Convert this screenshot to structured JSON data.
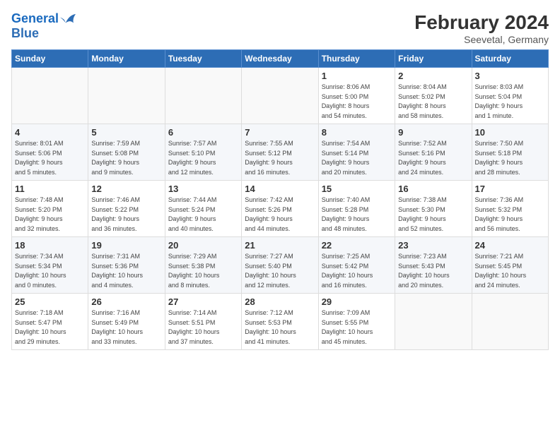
{
  "header": {
    "logo_line1": "General",
    "logo_line2": "Blue",
    "title": "February 2024",
    "subtitle": "Seevetal, Germany"
  },
  "days_of_week": [
    "Sunday",
    "Monday",
    "Tuesday",
    "Wednesday",
    "Thursday",
    "Friday",
    "Saturday"
  ],
  "weeks": [
    [
      {
        "day": "",
        "info": ""
      },
      {
        "day": "",
        "info": ""
      },
      {
        "day": "",
        "info": ""
      },
      {
        "day": "",
        "info": ""
      },
      {
        "day": "1",
        "info": "Sunrise: 8:06 AM\nSunset: 5:00 PM\nDaylight: 8 hours\nand 54 minutes."
      },
      {
        "day": "2",
        "info": "Sunrise: 8:04 AM\nSunset: 5:02 PM\nDaylight: 8 hours\nand 58 minutes."
      },
      {
        "day": "3",
        "info": "Sunrise: 8:03 AM\nSunset: 5:04 PM\nDaylight: 9 hours\nand 1 minute."
      }
    ],
    [
      {
        "day": "4",
        "info": "Sunrise: 8:01 AM\nSunset: 5:06 PM\nDaylight: 9 hours\nand 5 minutes."
      },
      {
        "day": "5",
        "info": "Sunrise: 7:59 AM\nSunset: 5:08 PM\nDaylight: 9 hours\nand 9 minutes."
      },
      {
        "day": "6",
        "info": "Sunrise: 7:57 AM\nSunset: 5:10 PM\nDaylight: 9 hours\nand 12 minutes."
      },
      {
        "day": "7",
        "info": "Sunrise: 7:55 AM\nSunset: 5:12 PM\nDaylight: 9 hours\nand 16 minutes."
      },
      {
        "day": "8",
        "info": "Sunrise: 7:54 AM\nSunset: 5:14 PM\nDaylight: 9 hours\nand 20 minutes."
      },
      {
        "day": "9",
        "info": "Sunrise: 7:52 AM\nSunset: 5:16 PM\nDaylight: 9 hours\nand 24 minutes."
      },
      {
        "day": "10",
        "info": "Sunrise: 7:50 AM\nSunset: 5:18 PM\nDaylight: 9 hours\nand 28 minutes."
      }
    ],
    [
      {
        "day": "11",
        "info": "Sunrise: 7:48 AM\nSunset: 5:20 PM\nDaylight: 9 hours\nand 32 minutes."
      },
      {
        "day": "12",
        "info": "Sunrise: 7:46 AM\nSunset: 5:22 PM\nDaylight: 9 hours\nand 36 minutes."
      },
      {
        "day": "13",
        "info": "Sunrise: 7:44 AM\nSunset: 5:24 PM\nDaylight: 9 hours\nand 40 minutes."
      },
      {
        "day": "14",
        "info": "Sunrise: 7:42 AM\nSunset: 5:26 PM\nDaylight: 9 hours\nand 44 minutes."
      },
      {
        "day": "15",
        "info": "Sunrise: 7:40 AM\nSunset: 5:28 PM\nDaylight: 9 hours\nand 48 minutes."
      },
      {
        "day": "16",
        "info": "Sunrise: 7:38 AM\nSunset: 5:30 PM\nDaylight: 9 hours\nand 52 minutes."
      },
      {
        "day": "17",
        "info": "Sunrise: 7:36 AM\nSunset: 5:32 PM\nDaylight: 9 hours\nand 56 minutes."
      }
    ],
    [
      {
        "day": "18",
        "info": "Sunrise: 7:34 AM\nSunset: 5:34 PM\nDaylight: 10 hours\nand 0 minutes."
      },
      {
        "day": "19",
        "info": "Sunrise: 7:31 AM\nSunset: 5:36 PM\nDaylight: 10 hours\nand 4 minutes."
      },
      {
        "day": "20",
        "info": "Sunrise: 7:29 AM\nSunset: 5:38 PM\nDaylight: 10 hours\nand 8 minutes."
      },
      {
        "day": "21",
        "info": "Sunrise: 7:27 AM\nSunset: 5:40 PM\nDaylight: 10 hours\nand 12 minutes."
      },
      {
        "day": "22",
        "info": "Sunrise: 7:25 AM\nSunset: 5:42 PM\nDaylight: 10 hours\nand 16 minutes."
      },
      {
        "day": "23",
        "info": "Sunrise: 7:23 AM\nSunset: 5:43 PM\nDaylight: 10 hours\nand 20 minutes."
      },
      {
        "day": "24",
        "info": "Sunrise: 7:21 AM\nSunset: 5:45 PM\nDaylight: 10 hours\nand 24 minutes."
      }
    ],
    [
      {
        "day": "25",
        "info": "Sunrise: 7:18 AM\nSunset: 5:47 PM\nDaylight: 10 hours\nand 29 minutes."
      },
      {
        "day": "26",
        "info": "Sunrise: 7:16 AM\nSunset: 5:49 PM\nDaylight: 10 hours\nand 33 minutes."
      },
      {
        "day": "27",
        "info": "Sunrise: 7:14 AM\nSunset: 5:51 PM\nDaylight: 10 hours\nand 37 minutes."
      },
      {
        "day": "28",
        "info": "Sunrise: 7:12 AM\nSunset: 5:53 PM\nDaylight: 10 hours\nand 41 minutes."
      },
      {
        "day": "29",
        "info": "Sunrise: 7:09 AM\nSunset: 5:55 PM\nDaylight: 10 hours\nand 45 minutes."
      },
      {
        "day": "",
        "info": ""
      },
      {
        "day": "",
        "info": ""
      }
    ]
  ]
}
